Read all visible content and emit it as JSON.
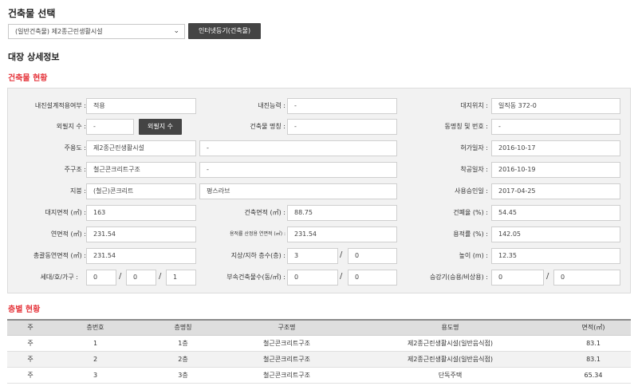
{
  "header": {
    "title": "건축물 선택",
    "select_value": "(일반건축물) 제2종근린생활시설",
    "internet_btn": "인터넷등기(건축물)"
  },
  "detail_title": "대장 상세정보",
  "building_section_title": "건축물 현황",
  "building": {
    "quake_design_label": "내진설계적용여부 :",
    "quake_design": "적용",
    "quake_ability_label": "내진능력 :",
    "quake_ability": "-",
    "site_label": "대지위치 :",
    "site": "일직동 372-0",
    "outer_count_label": "외필지 수 :",
    "outer_count": "-",
    "outer_btn": "외필지 수",
    "bld_name_label": "건축물 명칭 :",
    "bld_name": "-",
    "dong_label": "동명칭 및 번호 :",
    "dong": "-",
    "main_use_label": "주용도 :",
    "main_use": "제2종근린생활시설",
    "main_use_etc": "-",
    "permit_date_label": "허가일자 :",
    "permit_date": "2016-10-17",
    "structure_label": "주구조 :",
    "structure": "철근콘크리트구조",
    "structure_etc": "-",
    "start_date_label": "착공일자 :",
    "start_date": "2016-10-19",
    "roof_label": "지붕 :",
    "roof": "(철근)콘크리트",
    "roof_etc": "평스라브",
    "approval_date_label": "사용승인일 :",
    "approval_date": "2017-04-25",
    "land_area_label": "대지면적 (㎡) :",
    "land_area": "163",
    "building_area_label": "건축면적 (㎡) :",
    "building_area": "88.75",
    "coverage_label": "건폐율 (%) :",
    "coverage": "54.45",
    "total_area_label": "연면적 (㎡) :",
    "total_area": "231.54",
    "far_area_label": "용적률 산정용 연면적 (㎡) :",
    "far_area": "231.54",
    "far_label": "용적률 (%) :",
    "far": "142.05",
    "total_all_area_label": "총괄동연면적 (㎡) :",
    "total_all_area": "231.54",
    "floors_label": "지상/지하 층수(층) :",
    "floors_above": "3",
    "floors_below": "0",
    "height_label": "높이 (m) :",
    "height": "12.35",
    "households_label": "세대/호/가구 :",
    "households": "0",
    "units": "0",
    "families": "1",
    "annex_label": "부속건축물수(동/㎡) :",
    "annex_count": "0",
    "annex_area": "0",
    "elevator_label": "승강기(승용/비상용) :",
    "elevator_passenger": "0",
    "elevator_emergency": "0",
    "slash": "/"
  },
  "floor_section_title": "층별 현황",
  "floor_table": {
    "headers": [
      "주",
      "층번호",
      "층명칭",
      "구조명",
      "용도명",
      "면적(㎡)"
    ],
    "rows": [
      [
        "주",
        "1",
        "1층",
        "철근콘크리트구조",
        "제2종근린생활시설(일반음식점)",
        "83.1"
      ],
      [
        "주",
        "2",
        "2층",
        "철근콘크리트구조",
        "제2종근린생활시설(일반음식점)",
        "83.1"
      ],
      [
        "주",
        "3",
        "3층",
        "철근콘크리트구조",
        "단독주택",
        "65.34"
      ]
    ]
  }
}
